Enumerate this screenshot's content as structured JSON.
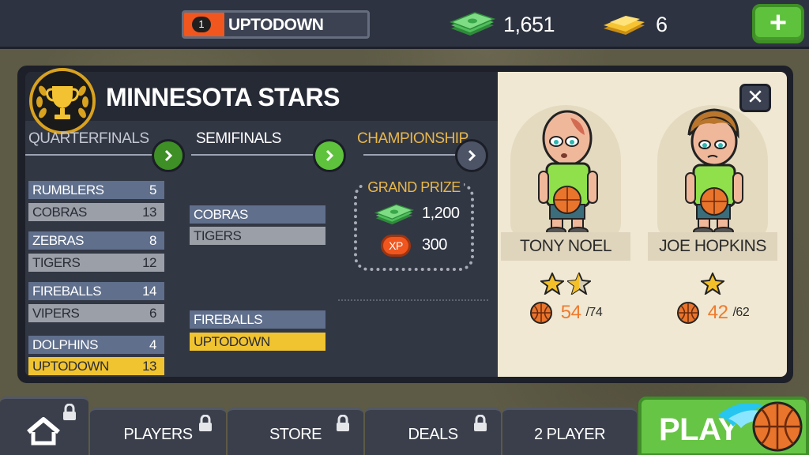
{
  "topbar": {
    "level": "1",
    "player_name": "UPTODOWN",
    "level_progress": 0.22,
    "cash_amount": "1,651",
    "gold_amount": "6",
    "cash_icon": "cash-stack-icon",
    "gold_icon": "gold-bars-icon",
    "plus_label": "+"
  },
  "panel": {
    "team_name": "MINNESOTA STARS",
    "rounds": [
      "QUARTERFINALS",
      "SEMIFINALS",
      "CHAMPIONSHIP"
    ],
    "quarterfinals": [
      {
        "team": "RUMBLERS",
        "score": "5"
      },
      {
        "team": "COBRAS",
        "score": "13"
      },
      {
        "team": "ZEBRAS",
        "score": "8"
      },
      {
        "team": "TIGERS",
        "score": "12"
      },
      {
        "team": "FIREBALLS",
        "score": "14"
      },
      {
        "team": "VIPERS",
        "score": "6"
      },
      {
        "team": "DOLPHINS",
        "score": "4"
      },
      {
        "team": "UPTODOWN",
        "score": "13"
      }
    ],
    "semifinals": [
      {
        "team": "COBRAS"
      },
      {
        "team": "TIGERS"
      },
      {
        "team": "FIREBALLS"
      },
      {
        "team": "UPTODOWN"
      }
    ],
    "grand_prize": {
      "title": "GRAND PRIZE",
      "cash": "1,200",
      "xp_label": "XP",
      "xp": "300"
    },
    "close_label": "✕"
  },
  "players": [
    {
      "name": "TONY NOEL",
      "stars": 1.5,
      "energy": "54",
      "energy_max": "/74"
    },
    {
      "name": "JOE HOPKINS",
      "stars": 1,
      "energy": "42",
      "energy_max": "/62"
    }
  ],
  "nav": {
    "home_icon": "home-icon",
    "tabs": [
      "PLAYERS",
      "STORE",
      "DEALS",
      "2 PLAYER"
    ],
    "play_label": "PLAY"
  },
  "colors": {
    "accent_orange": "#f0561e",
    "accent_green": "#5ec23c",
    "gold": "#f0c330",
    "panel_dark": "#1d2029"
  }
}
